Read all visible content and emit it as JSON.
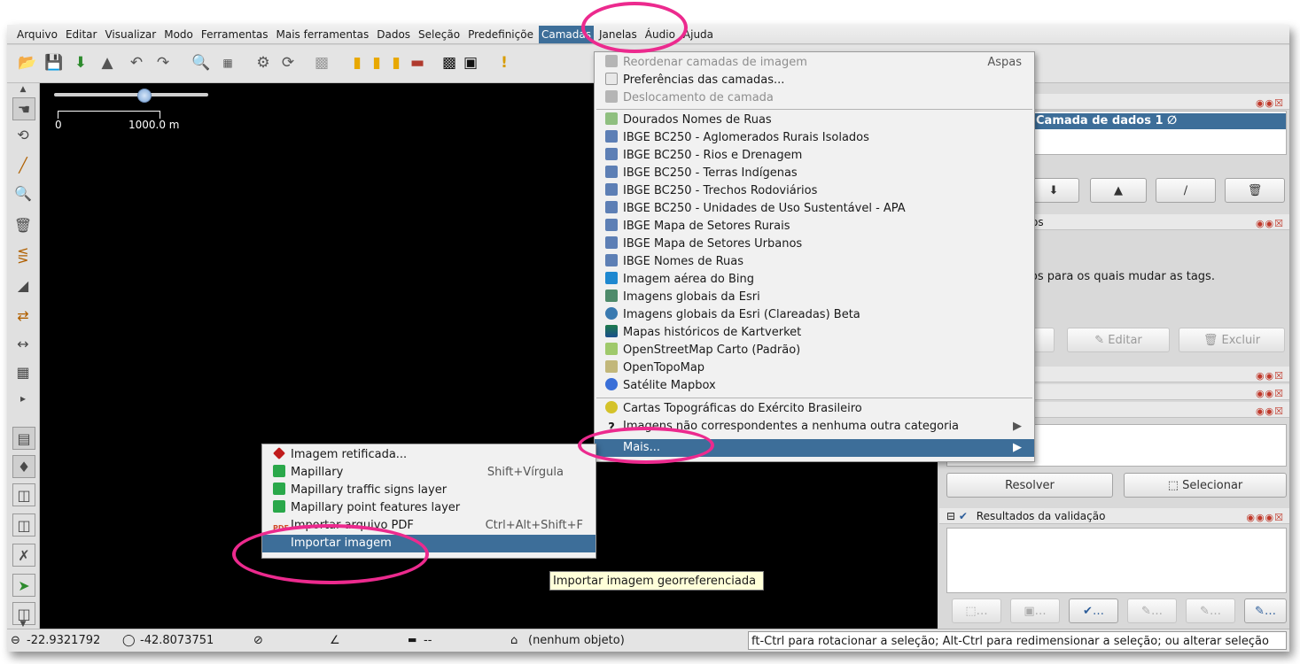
{
  "menubar": {
    "items": [
      "Arquivo",
      "Editar",
      "Visualizar",
      "Modo",
      "Ferramentas",
      "Mais ferramentas",
      "Dados",
      "Seleção",
      "Predefiniçõe",
      "Camadas",
      "Janelas",
      "Áudio",
      "Ajuda"
    ],
    "active_index": 9
  },
  "map": {
    "scale_label": "1000.0 m",
    "scale_zero": "0"
  },
  "layers_menu": {
    "items": [
      {
        "label": "Reordenar camadas de imagem",
        "shortcut": "Aspas",
        "disabled": true,
        "icon": "layers-icon"
      },
      {
        "label": "Preferências das camadas...",
        "shortcut": "",
        "disabled": false,
        "icon": "preferences-icon"
      },
      {
        "label": "Deslocamento de camada",
        "shortcut": "",
        "disabled": true,
        "icon": "offset-icon"
      },
      {
        "label": "Dourados Nomes de Ruas",
        "icon": "map-tile-icon"
      },
      {
        "label": "IBGE BC250 - Aglomerados Rurais Isolados",
        "icon": "ibge-icon"
      },
      {
        "label": "IBGE BC250 - Rios e Drenagem",
        "icon": "ibge-icon"
      },
      {
        "label": "IBGE BC250 - Terras Indígenas",
        "icon": "ibge-icon"
      },
      {
        "label": "IBGE BC250 - Trechos Rodoviários",
        "icon": "ibge-icon"
      },
      {
        "label": "IBGE BC250 - Unidades de Uso Sustentável - APA",
        "icon": "ibge-icon"
      },
      {
        "label": "IBGE Mapa de Setores Rurais",
        "icon": "ibge-icon"
      },
      {
        "label": "IBGE Mapa de Setores Urbanos",
        "icon": "ibge-icon"
      },
      {
        "label": "IBGE Nomes de Ruas",
        "icon": "ibge-icon"
      },
      {
        "label": "Imagem aérea do Bing",
        "icon": "bing-icon"
      },
      {
        "label": "Imagens globais da Esri",
        "icon": "esri-icon"
      },
      {
        "label": "Imagens globais da Esri (Clareadas) Beta",
        "icon": "globe-icon"
      },
      {
        "label": "Mapas históricos de Kartverket",
        "icon": "kartverket-icon"
      },
      {
        "label": "OpenStreetMap Carto (Padrão)",
        "icon": "osm-icon"
      },
      {
        "label": "OpenTopoMap",
        "icon": "topo-icon"
      },
      {
        "label": "Satélite Mapbox",
        "icon": "mapbox-icon"
      },
      {
        "label": "Cartas Topográficas do Exército Brasileiro",
        "icon": "army-icon"
      },
      {
        "label": "Imagens não correspondentes a nenhuma outra categoria",
        "icon": "question-icon"
      },
      {
        "label": "Mais...",
        "icon": ""
      }
    ]
  },
  "more_menu": {
    "items": [
      {
        "label": "Imagem retificada...",
        "shortcut": "",
        "icon": "rectified-icon"
      },
      {
        "label": "Mapillary",
        "shortcut": "Shift+Vírgula",
        "icon": "mapillary-icon"
      },
      {
        "label": "Mapillary traffic signs layer",
        "shortcut": "",
        "icon": "mapillary-icon"
      },
      {
        "label": "Mapillary point features layer",
        "shortcut": "",
        "icon": "mapillary-icon"
      },
      {
        "label": "Importar arquivo PDF",
        "shortcut": "Ctrl+Alt+Shift+F",
        "icon": "pdf-icon"
      },
      {
        "label": "Importar imagem",
        "shortcut": "",
        "icon": ""
      }
    ]
  },
  "tooltip": "Importar imagem georreferenciada",
  "right_panel": {
    "layer_name": "Camada de dados 1 ∅",
    "tags_text": "objetos para os quais mudar as tags.",
    "members_title": "mbros",
    "edit_label": "Editar",
    "delete_label": "Excluir",
    "resolve_label": "Resolver",
    "select_label": "Selecionar",
    "validation_title": "Resultados da validação"
  },
  "statusbar": {
    "lat": "-22.9321792",
    "lon": "-42.8073751",
    "distance": "--",
    "selection": "(nenhum objeto)",
    "hint": "ft-Ctrl para rotacionar a seleção; Alt-Ctrl para redimensionar a seleção; ou alterar seleção"
  },
  "colors": {
    "highlight": "#3d6e99",
    "annotation": "#ec2a8e",
    "map_bg": "#000000"
  }
}
